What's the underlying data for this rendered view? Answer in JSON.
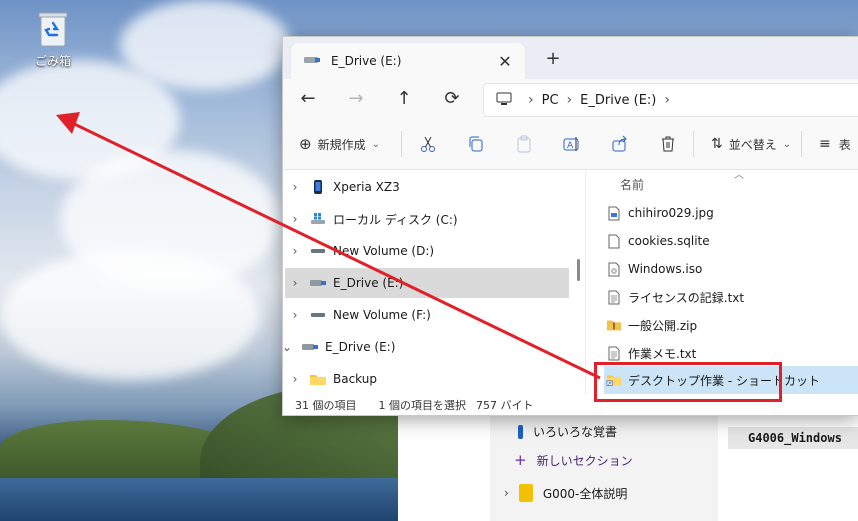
{
  "desktop": {
    "recycle_bin_label": "ごみ箱",
    "recycle_bin_icon": "recycle-bin-icon"
  },
  "background_app": {
    "items": [
      {
        "label": "いろいろな覚書",
        "icon": "notebook-section-icon"
      },
      {
        "label": "新しいセクション",
        "icon": "plus-icon"
      },
      {
        "label": "G000-全体説明",
        "icon": "notebook-icon"
      }
    ],
    "page_title": "G4006_Windows"
  },
  "explorer": {
    "tab_title": "E_Drive (E:)",
    "breadcrumb": [
      "PC",
      "E_Drive (E:)"
    ],
    "toolbar": {
      "new_label": "新規作成",
      "sort_label": "並べ替え",
      "view_label": "表"
    },
    "nav_items": [
      {
        "label": "Xperia XZ3",
        "icon": "phone-icon",
        "expand": "›",
        "indent": 0
      },
      {
        "label": "ローカル ディスク (C:)",
        "icon": "windows-drive-icon",
        "expand": "›",
        "indent": 0
      },
      {
        "label": "New Volume (D:)",
        "icon": "drive-icon",
        "expand": "›",
        "indent": 0
      },
      {
        "label": "E_Drive (E:)",
        "icon": "usb-drive-icon",
        "expand": "›",
        "indent": 0,
        "selected": true
      },
      {
        "label": "New Volume (F:)",
        "icon": "drive-icon",
        "expand": "›",
        "indent": 0
      },
      {
        "label": "E_Drive (E:)",
        "icon": "usb-drive-icon",
        "expand": "⌄",
        "indent": -8
      },
      {
        "label": "Backup",
        "icon": "folder-icon",
        "expand": "›",
        "indent": 0
      }
    ],
    "column_header": "名前",
    "files": [
      {
        "name": "chihiro029.jpg",
        "icon": "image-file-icon"
      },
      {
        "name": "cookies.sqlite",
        "icon": "file-icon"
      },
      {
        "name": "Windows.iso",
        "icon": "disc-image-icon"
      },
      {
        "name": "ライセンスの記録.txt",
        "icon": "text-file-icon"
      },
      {
        "name": "一般公開.zip",
        "icon": "zip-folder-icon"
      },
      {
        "name": "作業メモ.txt",
        "icon": "text-file-icon"
      },
      {
        "name": "デスクトップ作業 - ショートカット",
        "icon": "folder-shortcut-icon",
        "selected": true
      }
    ],
    "status": {
      "item_count": "31 個の項目",
      "selection": "1 個の項目を選択",
      "size": "757 バイト"
    }
  },
  "annotation": {
    "color": "#e0202a"
  }
}
